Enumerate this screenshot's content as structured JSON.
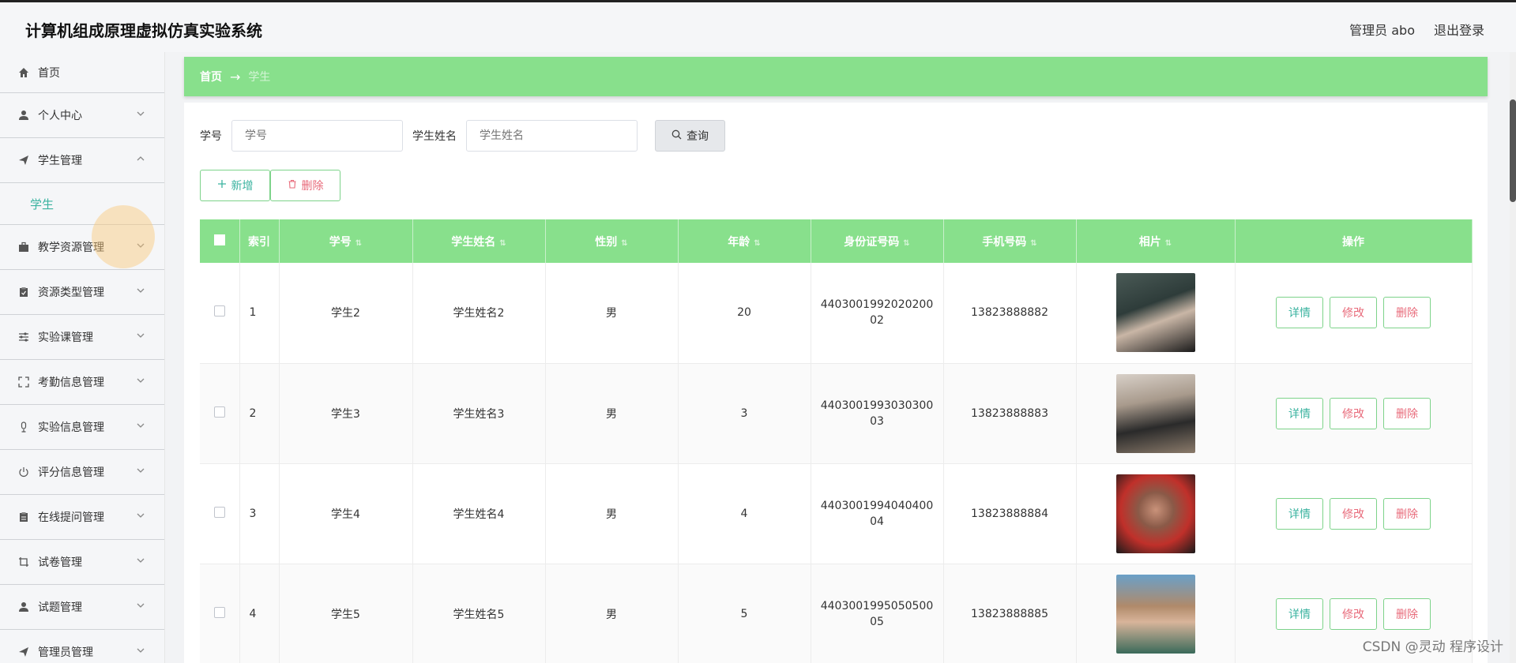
{
  "header": {
    "title": "计算机组成原理虚拟仿真实验系统",
    "user_label": "管理员 abo",
    "logout_label": "退出登录"
  },
  "sidebar": {
    "items": [
      {
        "label": "首页",
        "icon": "home-icon"
      },
      {
        "label": "个人中心",
        "icon": "user-icon"
      },
      {
        "label": "学生管理",
        "icon": "send-icon",
        "expanded": true
      },
      {
        "label": "教学资源管理",
        "icon": "suitcase-icon"
      },
      {
        "label": "资源类型管理",
        "icon": "clipboard-icon"
      },
      {
        "label": "实验课管理",
        "icon": "sliders-icon"
      },
      {
        "label": "考勤信息管理",
        "icon": "fullscreen-icon"
      },
      {
        "label": "实验信息管理",
        "icon": "microphone-icon"
      },
      {
        "label": "评分信息管理",
        "icon": "power-icon"
      },
      {
        "label": "在线提问管理",
        "icon": "document-icon"
      },
      {
        "label": "试卷管理",
        "icon": "crop-icon"
      },
      {
        "label": "试题管理",
        "icon": "user-icon"
      },
      {
        "label": "管理员管理",
        "icon": "send-icon"
      }
    ],
    "sub_item": "学生"
  },
  "breadcrumb": {
    "home": "首页",
    "separator": "→",
    "current": "学生"
  },
  "search": {
    "id_label": "学号",
    "id_placeholder": "学号",
    "name_label": "学生姓名",
    "name_placeholder": "学生姓名",
    "button_label": "查询"
  },
  "actions": {
    "add_label": "新增",
    "delete_label": "删除"
  },
  "table": {
    "columns": [
      "索引",
      "学号",
      "学生姓名",
      "性别",
      "年龄",
      "身份证号码",
      "手机号码",
      "相片",
      "操作"
    ],
    "rows": [
      {
        "index": "1",
        "id": "学生2",
        "name": "学生姓名2",
        "gender": "男",
        "age": "20",
        "idcard": "440300199202020002",
        "phone": "13823888882"
      },
      {
        "index": "2",
        "id": "学生3",
        "name": "学生姓名3",
        "gender": "男",
        "age": "3",
        "idcard": "440300199303030003",
        "phone": "13823888883"
      },
      {
        "index": "3",
        "id": "学生4",
        "name": "学生姓名4",
        "gender": "男",
        "age": "4",
        "idcard": "440300199404040004",
        "phone": "13823888884"
      },
      {
        "index": "4",
        "id": "学生5",
        "name": "学生姓名5",
        "gender": "男",
        "age": "5",
        "idcard": "440300199505050005",
        "phone": "13823888885"
      }
    ],
    "op_detail": "详情",
    "op_edit": "修改",
    "op_delete": "删除"
  },
  "watermark": "CSDN @灵动 程序设计",
  "colors": {
    "accent_green": "#88e08c",
    "teal_text": "#3bb3a0",
    "danger_text": "#e86a7a"
  }
}
